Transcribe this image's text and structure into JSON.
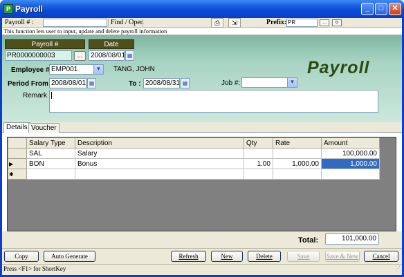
{
  "window": {
    "title": "Payroll"
  },
  "toolbar": {
    "payroll_label": "Payroll # :",
    "payroll_value": "",
    "find_open": "Find / Open",
    "prefix_label": "Prefix:",
    "prefix_value": "PR"
  },
  "info_text": "This function lets user to input, update and delete payroll information",
  "header": {
    "payroll_no_label": "Payroll #",
    "payroll_no_value": "PR0000000003",
    "date_label": "Date",
    "date_value": "2008/08/01",
    "big_title": "Payroll",
    "employee_label": "Employee #:",
    "employee_value": "EMP001",
    "employee_name": "TANG, JOHN",
    "period_from_label": "Period From :",
    "period_from_value": "2008/08/01",
    "to_label": "To :",
    "to_value": "2008/08/31",
    "job_label": "Job #:",
    "job_value": "",
    "remark_label": "Remark :",
    "remark_value": ""
  },
  "tabs": [
    {
      "label": "Details",
      "active": true
    },
    {
      "label": "Voucher",
      "active": false
    }
  ],
  "grid": {
    "columns": [
      "Salary Type",
      "Description",
      "Qty",
      "Rate",
      "Amount"
    ],
    "rows": [
      {
        "marker": "",
        "salary_type": "SAL",
        "description": "Salary",
        "qty": "",
        "rate": "",
        "amount": "100,000.00"
      },
      {
        "marker": "▶",
        "salary_type": "BON",
        "description": "Bonus",
        "qty": "1.00",
        "rate": "1,000.00",
        "amount": "1,000.00"
      },
      {
        "marker": "✱",
        "salary_type": "",
        "description": "",
        "qty": "",
        "rate": "",
        "amount": ""
      }
    ]
  },
  "total": {
    "label": "Total:",
    "value": "101,000.00"
  },
  "buttons": {
    "copy": "Copy",
    "auto_generate": "Auto Generate",
    "refresh": "Refresh",
    "new": "New",
    "delete": "Delete",
    "save": "Save",
    "save_new": "Save & New",
    "cancel": "Cancel"
  },
  "status_text": "Press <F1> for ShortKey",
  "icons": {
    "printer": "printer-icon",
    "export": "export-icon"
  },
  "colors": {
    "title_bar": "#0a48d6",
    "header_panel": "#a8d3c2",
    "header_box": "#4f4f1c",
    "selected_cell": "#316ac5",
    "big_title": "#2d4a10"
  }
}
